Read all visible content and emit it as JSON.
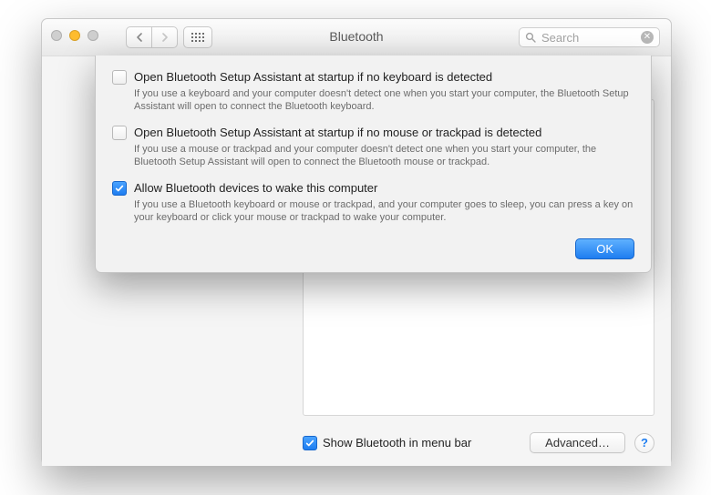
{
  "window": {
    "title": "Bluetooth",
    "search_placeholder": "Search"
  },
  "main": {
    "menubar_checkbox_label": "Show Bluetooth in menu bar",
    "menubar_checkbox_checked": true,
    "advanced_button": "Advanced…"
  },
  "sheet": {
    "options": [
      {
        "checked": false,
        "label": "Open Bluetooth Setup Assistant at startup if no keyboard is detected",
        "desc": "If you use a keyboard and your computer doesn't detect one when you start your computer, the Bluetooth Setup Assistant will open to connect the Bluetooth keyboard."
      },
      {
        "checked": false,
        "label": "Open Bluetooth Setup Assistant at startup if no mouse or trackpad is detected",
        "desc": "If you use a mouse or trackpad and your computer doesn't detect one when you start your computer, the Bluetooth Setup Assistant will open to connect the Bluetooth mouse or trackpad."
      },
      {
        "checked": true,
        "label": "Allow Bluetooth devices to wake this computer",
        "desc": "If you use a Bluetooth keyboard or mouse or trackpad, and your computer goes to sleep, you can press a key on your keyboard or click your mouse or trackpad to wake your computer."
      }
    ],
    "ok_button": "OK"
  }
}
